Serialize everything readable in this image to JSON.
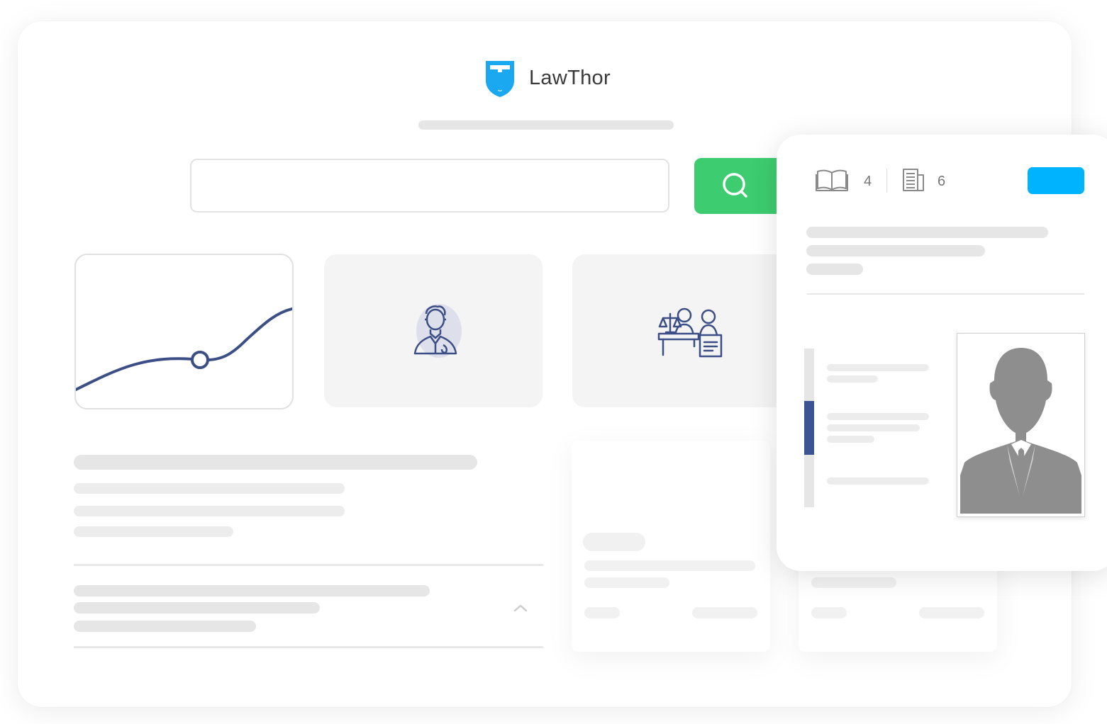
{
  "app": {
    "title": "LawThor",
    "logo_color": "#1aa9f0"
  },
  "search": {
    "value": "",
    "placeholder": "",
    "button_color": "#3dcc6f",
    "icon": "search-icon"
  },
  "cards": [
    {
      "name": "trend-chart-card",
      "icon": "line-chart-icon"
    },
    {
      "name": "lawyer-card",
      "icon": "lawyer-icon"
    },
    {
      "name": "court-card",
      "icon": "courtroom-icon"
    }
  ],
  "panel": {
    "books_icon": "book-icon",
    "books_count": "4",
    "documents_icon": "document-icon",
    "documents_count": "6",
    "action_button_color": "#00b3ff",
    "photo_icon": "person-silhouette-icon"
  },
  "colors": {
    "accent_navy": "#3b4f86",
    "skeleton": "#e6e6e6"
  }
}
